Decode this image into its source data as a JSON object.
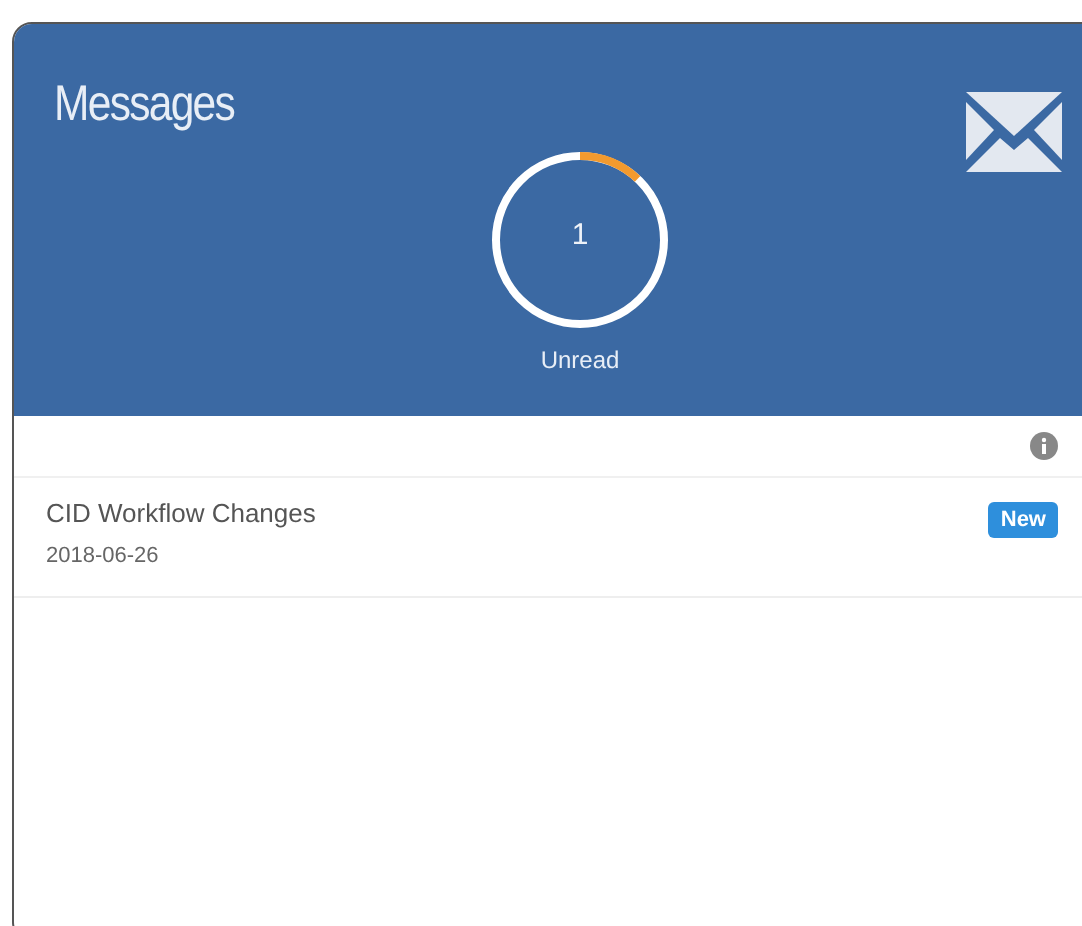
{
  "widget": {
    "title": "Messages",
    "unread": {
      "count": "1",
      "label": "Unread",
      "level": 0.12
    }
  },
  "messages": [
    {
      "title": "CID Workflow Changes",
      "date": "2018-06-26",
      "badge": "New",
      "is_new": true
    }
  ]
}
